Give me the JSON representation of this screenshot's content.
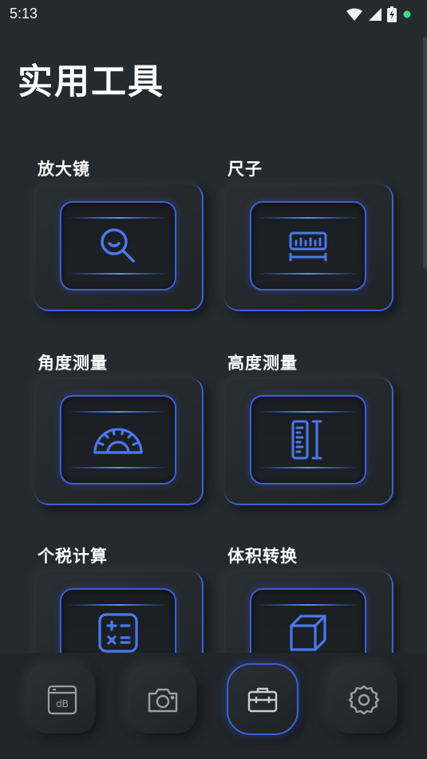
{
  "status": {
    "time": "5:13"
  },
  "header": {
    "title": "实用工具"
  },
  "tools": [
    {
      "label": "放大镜",
      "icon": "magnifier-icon"
    },
    {
      "label": "尺子",
      "icon": "ruler-icon"
    },
    {
      "label": "角度测量",
      "icon": "protractor-icon"
    },
    {
      "label": "高度测量",
      "icon": "height-ruler-icon"
    },
    {
      "label": "个税计算",
      "icon": "calculator-icon"
    },
    {
      "label": "体积转换",
      "icon": "cube-icon"
    }
  ],
  "nav": [
    {
      "icon": "decibel-icon",
      "label": "dB",
      "active": false
    },
    {
      "icon": "camera-icon",
      "active": false
    },
    {
      "icon": "toolbox-icon",
      "active": true
    },
    {
      "icon": "gear-icon",
      "active": false
    }
  ],
  "colors": {
    "accent": "#3d5ed8",
    "background": "#252a2e",
    "status_dot": "#3ddc84"
  }
}
